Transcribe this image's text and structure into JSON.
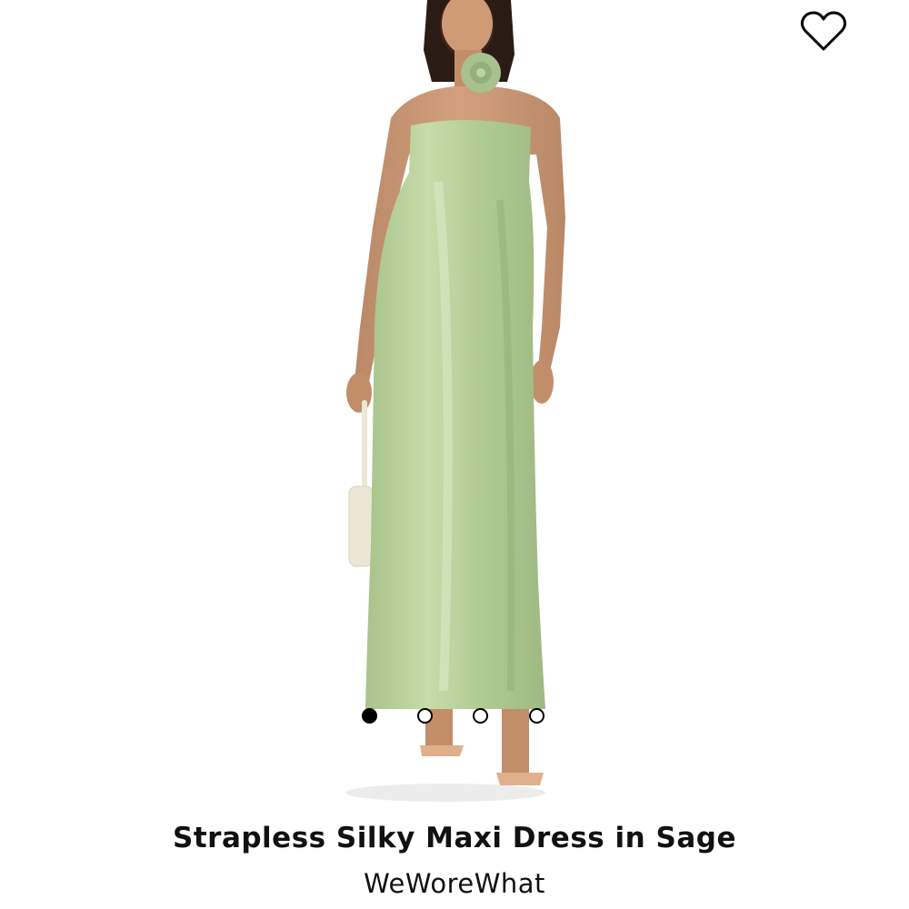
{
  "product": {
    "title": "Strapless Silky Maxi Dress in Sage",
    "brand": "WeWoreWhat"
  },
  "gallery": {
    "image_icon": "model-wearing-dress-image",
    "dress_color": "#b7cf9c",
    "total_images": 4,
    "active_index": 0
  },
  "wishlist": {
    "icon": "heart-outline-icon"
  }
}
